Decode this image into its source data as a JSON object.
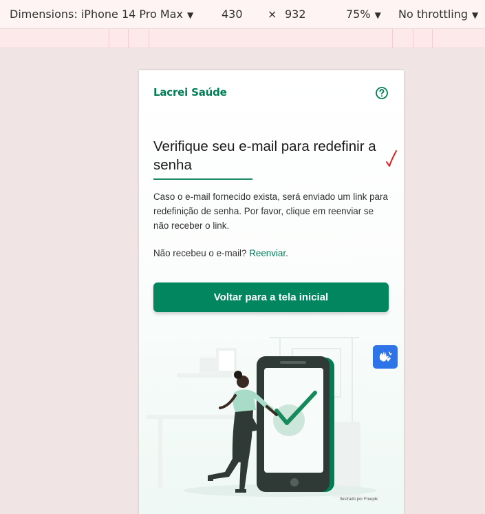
{
  "devtools": {
    "dimensions_label": "Dimensions: iPhone 14 Pro Max",
    "width": "430",
    "times": "×",
    "height": "932",
    "zoom": "75%",
    "throttling": "No throttling",
    "caret": "▼"
  },
  "app": {
    "brand": "Lacrei Saúde",
    "title": "Verifique seu e-mail para redefinir a senha",
    "description": "Caso o e-mail fornecido exista, será enviado um link para redefinição de senha. Por favor, clique em reenviar se não receber o link.",
    "resend_prompt": "Não recebeu o e-mail? ",
    "resend_link": "Reenviar",
    "resend_period": ".",
    "back_button": "Voltar para a tela inicial",
    "credit": "Ilustrado por Freepik"
  },
  "colors": {
    "brand_green": "#017d55",
    "button_green": "#018660",
    "accessibility_blue": "#2c74e8",
    "annotation_red": "#e02020"
  },
  "icons": {
    "help": "question-circle-icon",
    "accessibility": "sign-language-hands-icon",
    "annotation": "red-checkmark-icon",
    "illustration": "phone-checkmark-illustration"
  }
}
